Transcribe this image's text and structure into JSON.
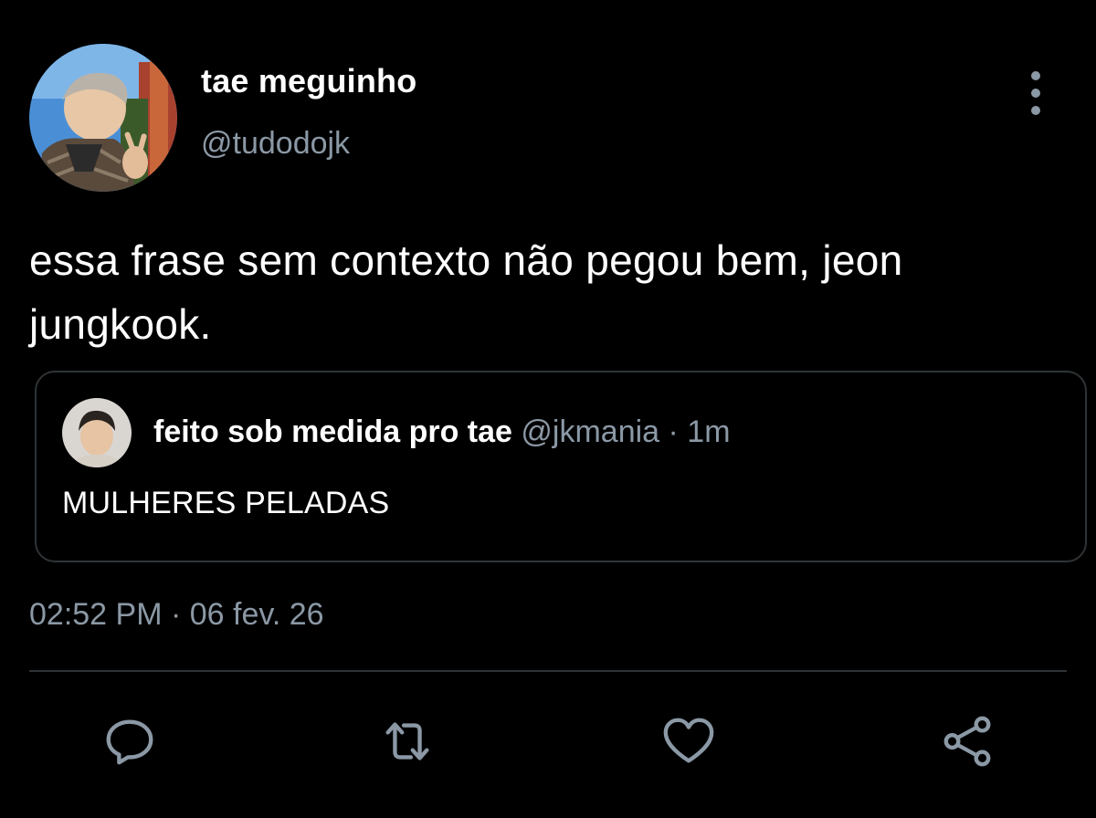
{
  "tweet": {
    "author": {
      "display_name": "tae meguinho",
      "handle": "@tudodojk"
    },
    "text": "essa frase sem contexto não pegou bem, jeon jungkook.",
    "timestamp": "02:52 PM · 06 fev. 26"
  },
  "quote": {
    "display_name": "feito sob medida pro tae",
    "handle": "@jkmania",
    "separator": " · ",
    "time": "1m",
    "text": "MULHERES PELADAS"
  },
  "icons": {
    "more": "vertical-dots-icon",
    "reply": "speech-bubble-icon",
    "retweet": "retweet-arrows-icon",
    "like": "heart-icon",
    "share": "share-nodes-icon"
  },
  "colors": {
    "background": "#000000",
    "text_primary": "#ffffff",
    "text_secondary": "#8b98a5",
    "border": "#2f3336"
  }
}
